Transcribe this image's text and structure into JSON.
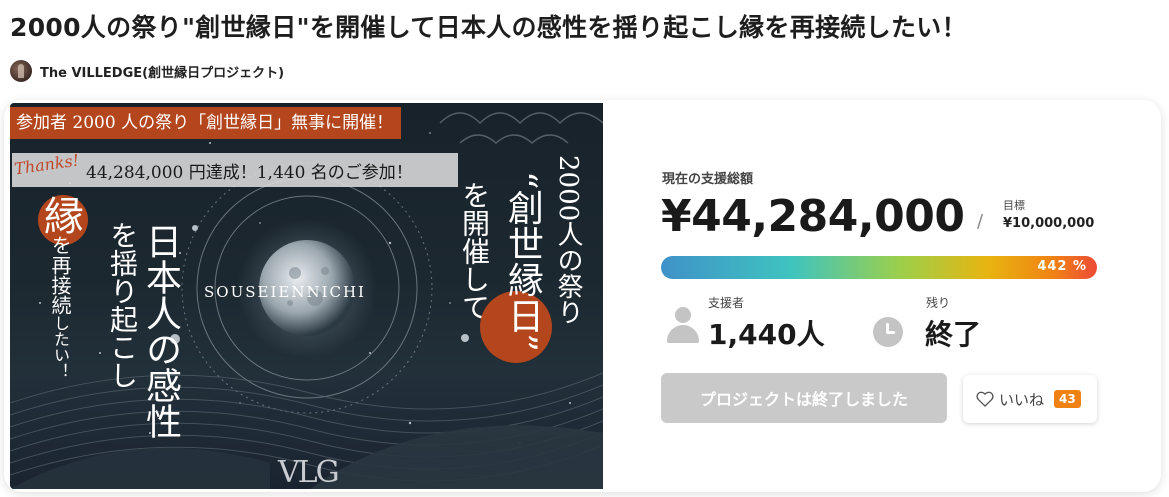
{
  "project": {
    "title": "2000人の祭り\"創世縁日\"を開催して日本人の感性を揺り起こし縁を再接続したい！",
    "owner_name": "The VILLEDGE(創世縁日プロジェクト)"
  },
  "hero": {
    "banner_top": "参加者 2000 人の祭り「創世縁日」無事に開催！",
    "thanks_script": "Thanks!",
    "banner_result": "44,284,000 円達成！1,440 名のご参加！",
    "col_en": "縁",
    "col_en_rest": "を再接続",
    "col_en_small": "したい！",
    "col_wo": "を揺り起こし",
    "col_nihon": "日本人の感性",
    "col_kanjin": "を開催して",
    "col_sousei": "“創世縁日”",
    "col_2000": "2000人の祭り",
    "moon_label": "SOUSEIENNICHI",
    "logo": "VLG"
  },
  "funding": {
    "total_label": "現在の支援総額",
    "total_amount": "¥44,284,000",
    "slash": "/",
    "goal_label": "目標",
    "goal_amount": "¥10,000,000",
    "percent_text": "442 %",
    "percent_value": 442
  },
  "stats": {
    "supporters_label": "支援者",
    "supporters_value": "1,440人",
    "remaining_label": "残り",
    "remaining_value": "終了"
  },
  "actions": {
    "ended_button": "プロジェクトは終了しました",
    "like_label": "いいね",
    "like_count": "43"
  },
  "colors": {
    "accent_orange": "#f08214",
    "hero_red": "#b4461e",
    "disabled_button": "#c9c9c9"
  }
}
